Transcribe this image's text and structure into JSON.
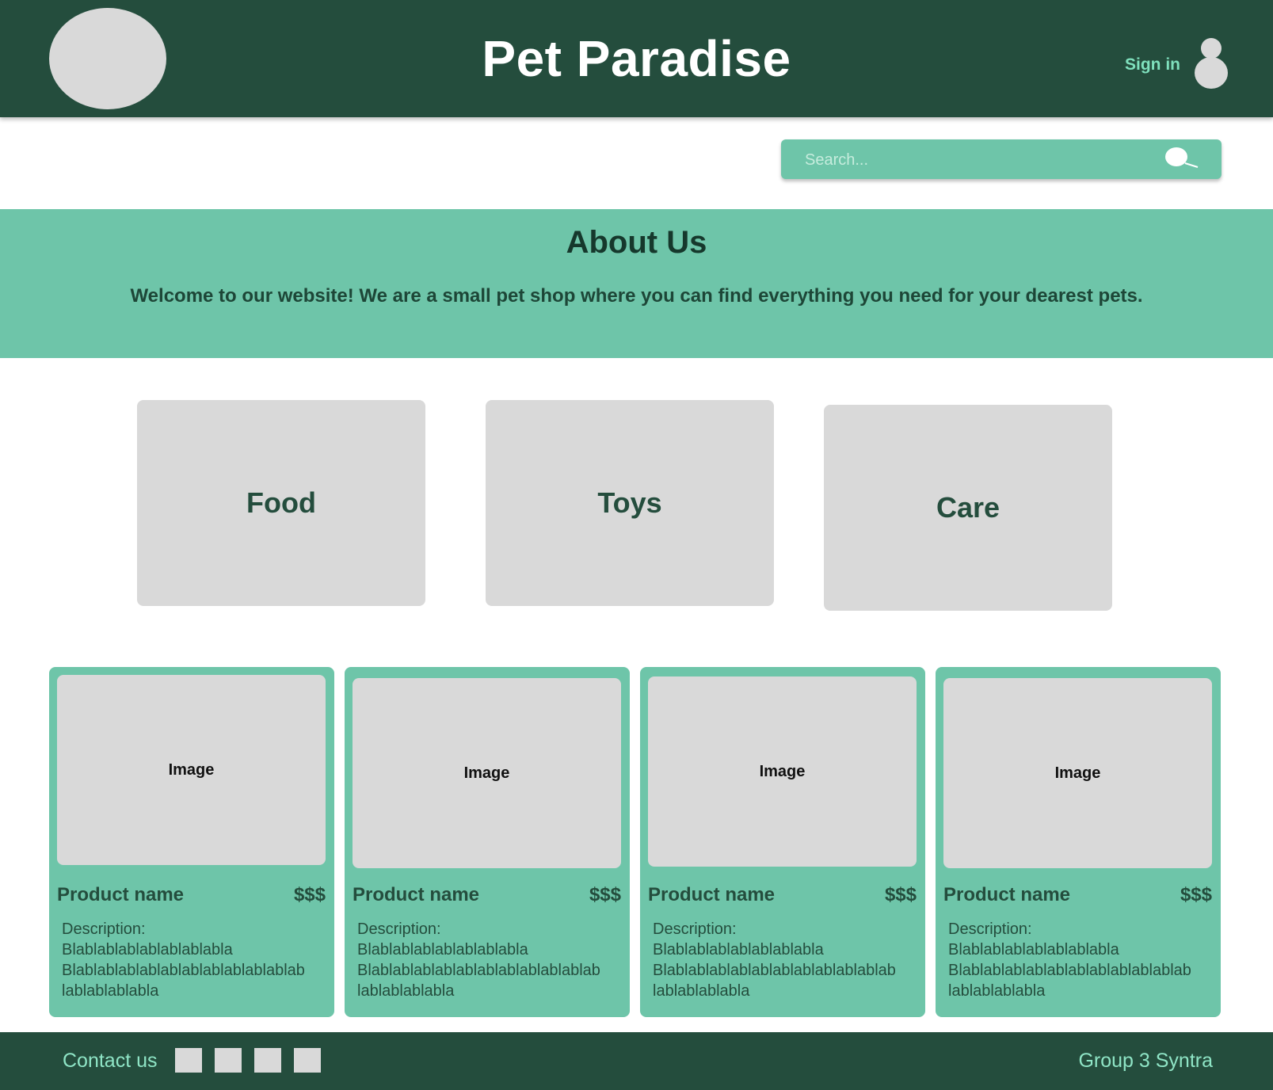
{
  "header": {
    "title": "Pet Paradise",
    "sign_in": "Sign in"
  },
  "search": {
    "placeholder": "Search..."
  },
  "about": {
    "title": "About Us",
    "text": "Welcome to our website! We are a small pet shop where you can find everything you need for your dearest pets."
  },
  "categories": [
    {
      "label": "Food"
    },
    {
      "label": "Toys"
    },
    {
      "label": "Care"
    }
  ],
  "products": [
    {
      "image_label": "Image",
      "name": "Product name",
      "price": "$$$",
      "desc_label": "Description:",
      "desc_lines": [
        "Blablablablablablablabla",
        "Blablablablablablablablablablablab",
        "lablablablabla"
      ]
    },
    {
      "image_label": "Image",
      "name": "Product name",
      "price": "$$$",
      "desc_label": "Description:",
      "desc_lines": [
        "Blablablablablablablabla",
        "Blablablablablablablablablablablab",
        "lablablablabla"
      ]
    },
    {
      "image_label": "Image",
      "name": "Product name",
      "price": "$$$",
      "desc_label": "Description:",
      "desc_lines": [
        "Blablablablablablablabla",
        "Blablablablablablablablablablablab",
        "lablablablabla"
      ]
    },
    {
      "image_label": "Image",
      "name": "Product name",
      "price": "$$$",
      "desc_label": "Description:",
      "desc_lines": [
        "Blablablablablablablabla",
        "Blablablablablablablablablablablab",
        "lablablablabla"
      ]
    }
  ],
  "footer": {
    "contact": "Contact us",
    "credit": "Group 3 Syntra"
  },
  "colors": {
    "header_bg": "#244d3d",
    "accent": "#6ec5a9",
    "placeholder_gray": "#d9d9d9",
    "link_green": "#8fe5c6"
  }
}
